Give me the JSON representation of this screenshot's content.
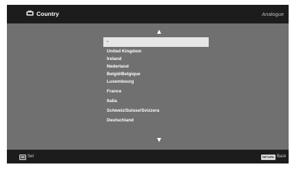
{
  "header": {
    "icon": "tv-icon",
    "title": "Country",
    "mode": "Analogue"
  },
  "list": {
    "scroll_up_icon": "triangle-up-icon",
    "scroll_down_icon": "triangle-down-icon",
    "selected_index": 0,
    "items": [
      "-",
      "United Kingdom",
      "Ireland",
      "Nederland",
      "België/Belgique",
      "Luxembourg",
      "France",
      "Italia",
      "Schweiz/Suisse/Svizzera",
      "Deutschland"
    ]
  },
  "footer": {
    "set_key": "OK",
    "set_label": "Set",
    "return_key": "RETURN",
    "back_label": "Back"
  },
  "colors": {
    "background": "#707070",
    "bar": "#1c1c1c",
    "highlight": "#e6e6e6",
    "text": "#ffffff"
  }
}
